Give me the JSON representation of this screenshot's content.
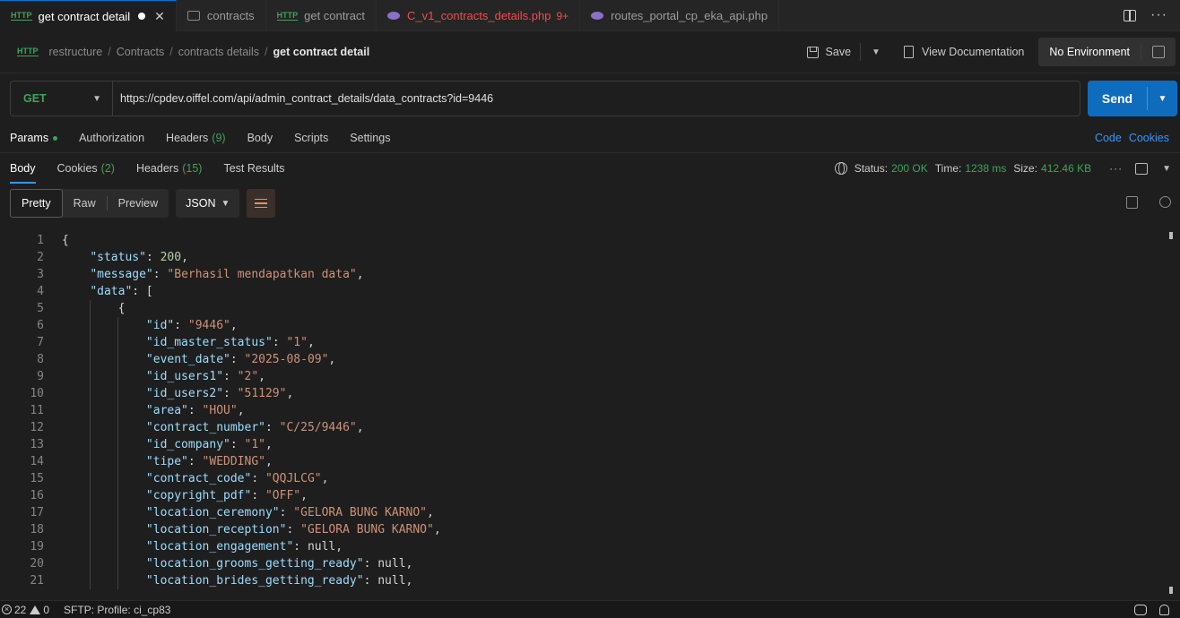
{
  "tabs": [
    {
      "label": "get contract detail",
      "icon": "http-icon",
      "active": true,
      "dirty": true
    },
    {
      "label": "contracts",
      "icon": "folder-icon"
    },
    {
      "label": "get contract",
      "icon": "http-icon"
    },
    {
      "label": "C_v1_contracts_details.php",
      "icon": "php-icon",
      "error": true,
      "badge": "9+"
    },
    {
      "label": "routes_portal_cp_eka_api.php",
      "icon": "php-icon"
    }
  ],
  "breadcrumb": {
    "items": [
      "restructure",
      "Contracts",
      "contracts details"
    ],
    "current": "get contract detail"
  },
  "actions": {
    "save": "Save",
    "view_docs": "View Documentation",
    "environment": "No Environment"
  },
  "request": {
    "method": "GET",
    "url": "https://cpdev.oiffel.com/api/admin_contract_details/data_contracts?id=9446",
    "send": "Send"
  },
  "request_tabs": {
    "params": "Params",
    "authorization": "Authorization",
    "headers": "Headers",
    "headers_count": "(9)",
    "body": "Body",
    "scripts": "Scripts",
    "settings": "Settings",
    "code": "Code",
    "cookies": "Cookies"
  },
  "response_tabs": {
    "body": "Body",
    "cookies": "Cookies",
    "cookies_count": "(2)",
    "headers": "Headers",
    "headers_count": "(15)",
    "test_results": "Test Results"
  },
  "response_status": {
    "status_label": "Status:",
    "status": "200 OK",
    "time_label": "Time:",
    "time": "1238 ms",
    "size_label": "Size:",
    "size": "412.46 KB"
  },
  "view_modes": {
    "pretty": "Pretty",
    "raw": "Raw",
    "preview": "Preview",
    "format": "JSON"
  },
  "code_lines": [
    {
      "n": "1",
      "indent": 0,
      "parts": [
        [
          "p",
          "{"
        ]
      ]
    },
    {
      "n": "2",
      "indent": 1,
      "parts": [
        [
          "k",
          "\"status\""
        ],
        [
          "p",
          ": "
        ],
        [
          "n",
          "200"
        ],
        [
          "p",
          ","
        ]
      ]
    },
    {
      "n": "3",
      "indent": 1,
      "parts": [
        [
          "k",
          "\"message\""
        ],
        [
          "p",
          ": "
        ],
        [
          "s",
          "\"Berhasil mendapatkan data\""
        ],
        [
          "p",
          ","
        ]
      ]
    },
    {
      "n": "4",
      "indent": 1,
      "parts": [
        [
          "k",
          "\"data\""
        ],
        [
          "p",
          ": ["
        ]
      ]
    },
    {
      "n": "5",
      "indent": 2,
      "parts": [
        [
          "p",
          "{"
        ]
      ]
    },
    {
      "n": "6",
      "indent": 3,
      "parts": [
        [
          "k",
          "\"id\""
        ],
        [
          "p",
          ": "
        ],
        [
          "s",
          "\"9446\""
        ],
        [
          "p",
          ","
        ]
      ]
    },
    {
      "n": "7",
      "indent": 3,
      "parts": [
        [
          "k",
          "\"id_master_status\""
        ],
        [
          "p",
          ": "
        ],
        [
          "s",
          "\"1\""
        ],
        [
          "p",
          ","
        ]
      ]
    },
    {
      "n": "8",
      "indent": 3,
      "parts": [
        [
          "k",
          "\"event_date\""
        ],
        [
          "p",
          ": "
        ],
        [
          "s",
          "\"2025-08-09\""
        ],
        [
          "p",
          ","
        ]
      ]
    },
    {
      "n": "9",
      "indent": 3,
      "parts": [
        [
          "k",
          "\"id_users1\""
        ],
        [
          "p",
          ": "
        ],
        [
          "s",
          "\"2\""
        ],
        [
          "p",
          ","
        ]
      ]
    },
    {
      "n": "10",
      "indent": 3,
      "parts": [
        [
          "k",
          "\"id_users2\""
        ],
        [
          "p",
          ": "
        ],
        [
          "s",
          "\"51129\""
        ],
        [
          "p",
          ","
        ]
      ]
    },
    {
      "n": "11",
      "indent": 3,
      "parts": [
        [
          "k",
          "\"area\""
        ],
        [
          "p",
          ": "
        ],
        [
          "s",
          "\"HOU\""
        ],
        [
          "p",
          ","
        ]
      ]
    },
    {
      "n": "12",
      "indent": 3,
      "parts": [
        [
          "k",
          "\"contract_number\""
        ],
        [
          "p",
          ": "
        ],
        [
          "s",
          "\"C/25/9446\""
        ],
        [
          "p",
          ","
        ]
      ]
    },
    {
      "n": "13",
      "indent": 3,
      "parts": [
        [
          "k",
          "\"id_company\""
        ],
        [
          "p",
          ": "
        ],
        [
          "s",
          "\"1\""
        ],
        [
          "p",
          ","
        ]
      ]
    },
    {
      "n": "14",
      "indent": 3,
      "parts": [
        [
          "k",
          "\"tipe\""
        ],
        [
          "p",
          ": "
        ],
        [
          "s",
          "\"WEDDING\""
        ],
        [
          "p",
          ","
        ]
      ]
    },
    {
      "n": "15",
      "indent": 3,
      "parts": [
        [
          "k",
          "\"contract_code\""
        ],
        [
          "p",
          ": "
        ],
        [
          "s",
          "\"QQJLCG\""
        ],
        [
          "p",
          ","
        ]
      ]
    },
    {
      "n": "16",
      "indent": 3,
      "parts": [
        [
          "k",
          "\"copyright_pdf\""
        ],
        [
          "p",
          ": "
        ],
        [
          "s",
          "\"OFF\""
        ],
        [
          "p",
          ","
        ]
      ]
    },
    {
      "n": "17",
      "indent": 3,
      "parts": [
        [
          "k",
          "\"location_ceremony\""
        ],
        [
          "p",
          ": "
        ],
        [
          "s",
          "\"GELORA BUNG KARNO\""
        ],
        [
          "p",
          ","
        ]
      ]
    },
    {
      "n": "18",
      "indent": 3,
      "parts": [
        [
          "k",
          "\"location_reception\""
        ],
        [
          "p",
          ": "
        ],
        [
          "s",
          "\"GELORA BUNG KARNO\""
        ],
        [
          "p",
          ","
        ]
      ]
    },
    {
      "n": "19",
      "indent": 3,
      "parts": [
        [
          "k",
          "\"location_engagement\""
        ],
        [
          "p",
          ": "
        ],
        [
          "p",
          "null"
        ],
        [
          "p",
          ","
        ]
      ]
    },
    {
      "n": "20",
      "indent": 3,
      "parts": [
        [
          "k",
          "\"location_grooms_getting_ready\""
        ],
        [
          "p",
          ": "
        ],
        [
          "p",
          "null"
        ],
        [
          "p",
          ","
        ]
      ]
    },
    {
      "n": "21",
      "indent": 3,
      "parts": [
        [
          "k",
          "\"location_brides_getting_ready\""
        ],
        [
          "p",
          ": "
        ],
        [
          "p",
          "null"
        ],
        [
          "p",
          ","
        ]
      ]
    }
  ],
  "statusbar": {
    "errors": "22",
    "warnings": "0",
    "sftp": "SFTP: Profile: ci_cp83"
  },
  "colors": {
    "accent": "#0f6cbd",
    "get_method": "#3fa35b",
    "json_key": "#9cdcfe",
    "json_string": "#ce9178",
    "json_number": "#b5cea8",
    "error_tab": "#f14c4c"
  }
}
